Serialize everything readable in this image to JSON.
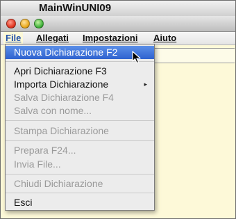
{
  "app": {
    "name": "MainWinUNI09",
    "apple_glyph": ""
  },
  "menubar": {
    "items": [
      {
        "label": "File"
      },
      {
        "label": "Allegati"
      },
      {
        "label": "Impostazioni"
      },
      {
        "label": "Aiuto"
      }
    ]
  },
  "file_menu": {
    "items": [
      {
        "label": "Nuova Dichiarazione  F2",
        "state": "selected"
      },
      {
        "label": "Apri Dichiarazione    F3",
        "state": "enabled"
      },
      {
        "label": "Importa Dichiarazione",
        "state": "enabled",
        "submenu": true
      },
      {
        "label": "Salva Dichiarazione    F4",
        "state": "disabled"
      },
      {
        "label": "Salva con nome...",
        "state": "disabled"
      },
      {
        "label": "Stampa Dichiarazione",
        "state": "disabled"
      },
      {
        "label": "Prepara F24...",
        "state": "disabled"
      },
      {
        "label": "Invia File...",
        "state": "disabled"
      },
      {
        "label": "Chiudi Dichiarazione",
        "state": "disabled"
      },
      {
        "label": "Esci",
        "state": "enabled"
      }
    ]
  },
  "icons": {
    "submenu_arrow": "▸"
  },
  "colors": {
    "selection": "#2f62cf",
    "disabled_text": "#9a9a9a",
    "window_background": "#fdf9d8"
  }
}
